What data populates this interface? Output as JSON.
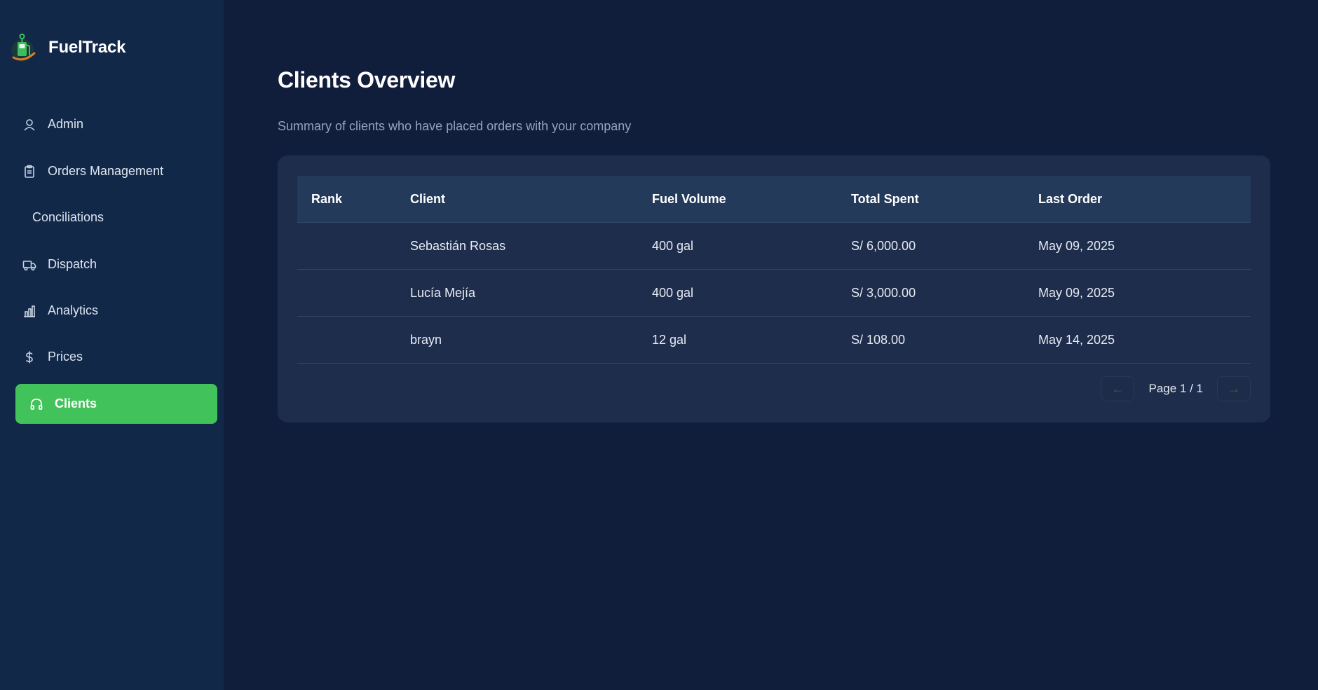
{
  "app": {
    "name": "FuelTrack"
  },
  "sidebar": {
    "items": [
      {
        "label": "Admin",
        "icon": "user-icon"
      },
      {
        "label": "Orders Management",
        "icon": "clipboard-icon"
      },
      {
        "label": "Conciliations",
        "icon": ""
      },
      {
        "label": "Dispatch",
        "icon": "truck-icon"
      },
      {
        "label": "Analytics",
        "icon": "bar-chart-icon"
      },
      {
        "label": "Prices",
        "icon": "dollar-icon"
      },
      {
        "label": "Clients",
        "icon": "headphones-icon",
        "active": true
      }
    ]
  },
  "main": {
    "title": "Clients Overview",
    "subtitle": "Summary of clients who have placed orders with your company",
    "table": {
      "headers": {
        "rank": "Rank",
        "client": "Client",
        "volume": "Fuel Volume",
        "total": "Total Spent",
        "last": "Last Order"
      },
      "rows": [
        {
          "rank": "",
          "client": "Sebastián Rosas",
          "volume": "400 gal",
          "total": "S/ 6,000.00",
          "last": "May 09, 2025"
        },
        {
          "rank": "",
          "client": "Lucía Mejía",
          "volume": "400 gal",
          "total": "S/ 3,000.00",
          "last": "May 09, 2025"
        },
        {
          "rank": "",
          "client": "brayn",
          "volume": "12 gal",
          "total": "S/ 108.00",
          "last": "May 14, 2025"
        }
      ]
    },
    "pagination": {
      "prev": "←",
      "next": "→",
      "text": "Page 1 / 1"
    }
  },
  "colors": {
    "background": "#111e3b",
    "sidebar": "#112849",
    "card": "#1f2d4c",
    "accent": "#42c25b"
  }
}
